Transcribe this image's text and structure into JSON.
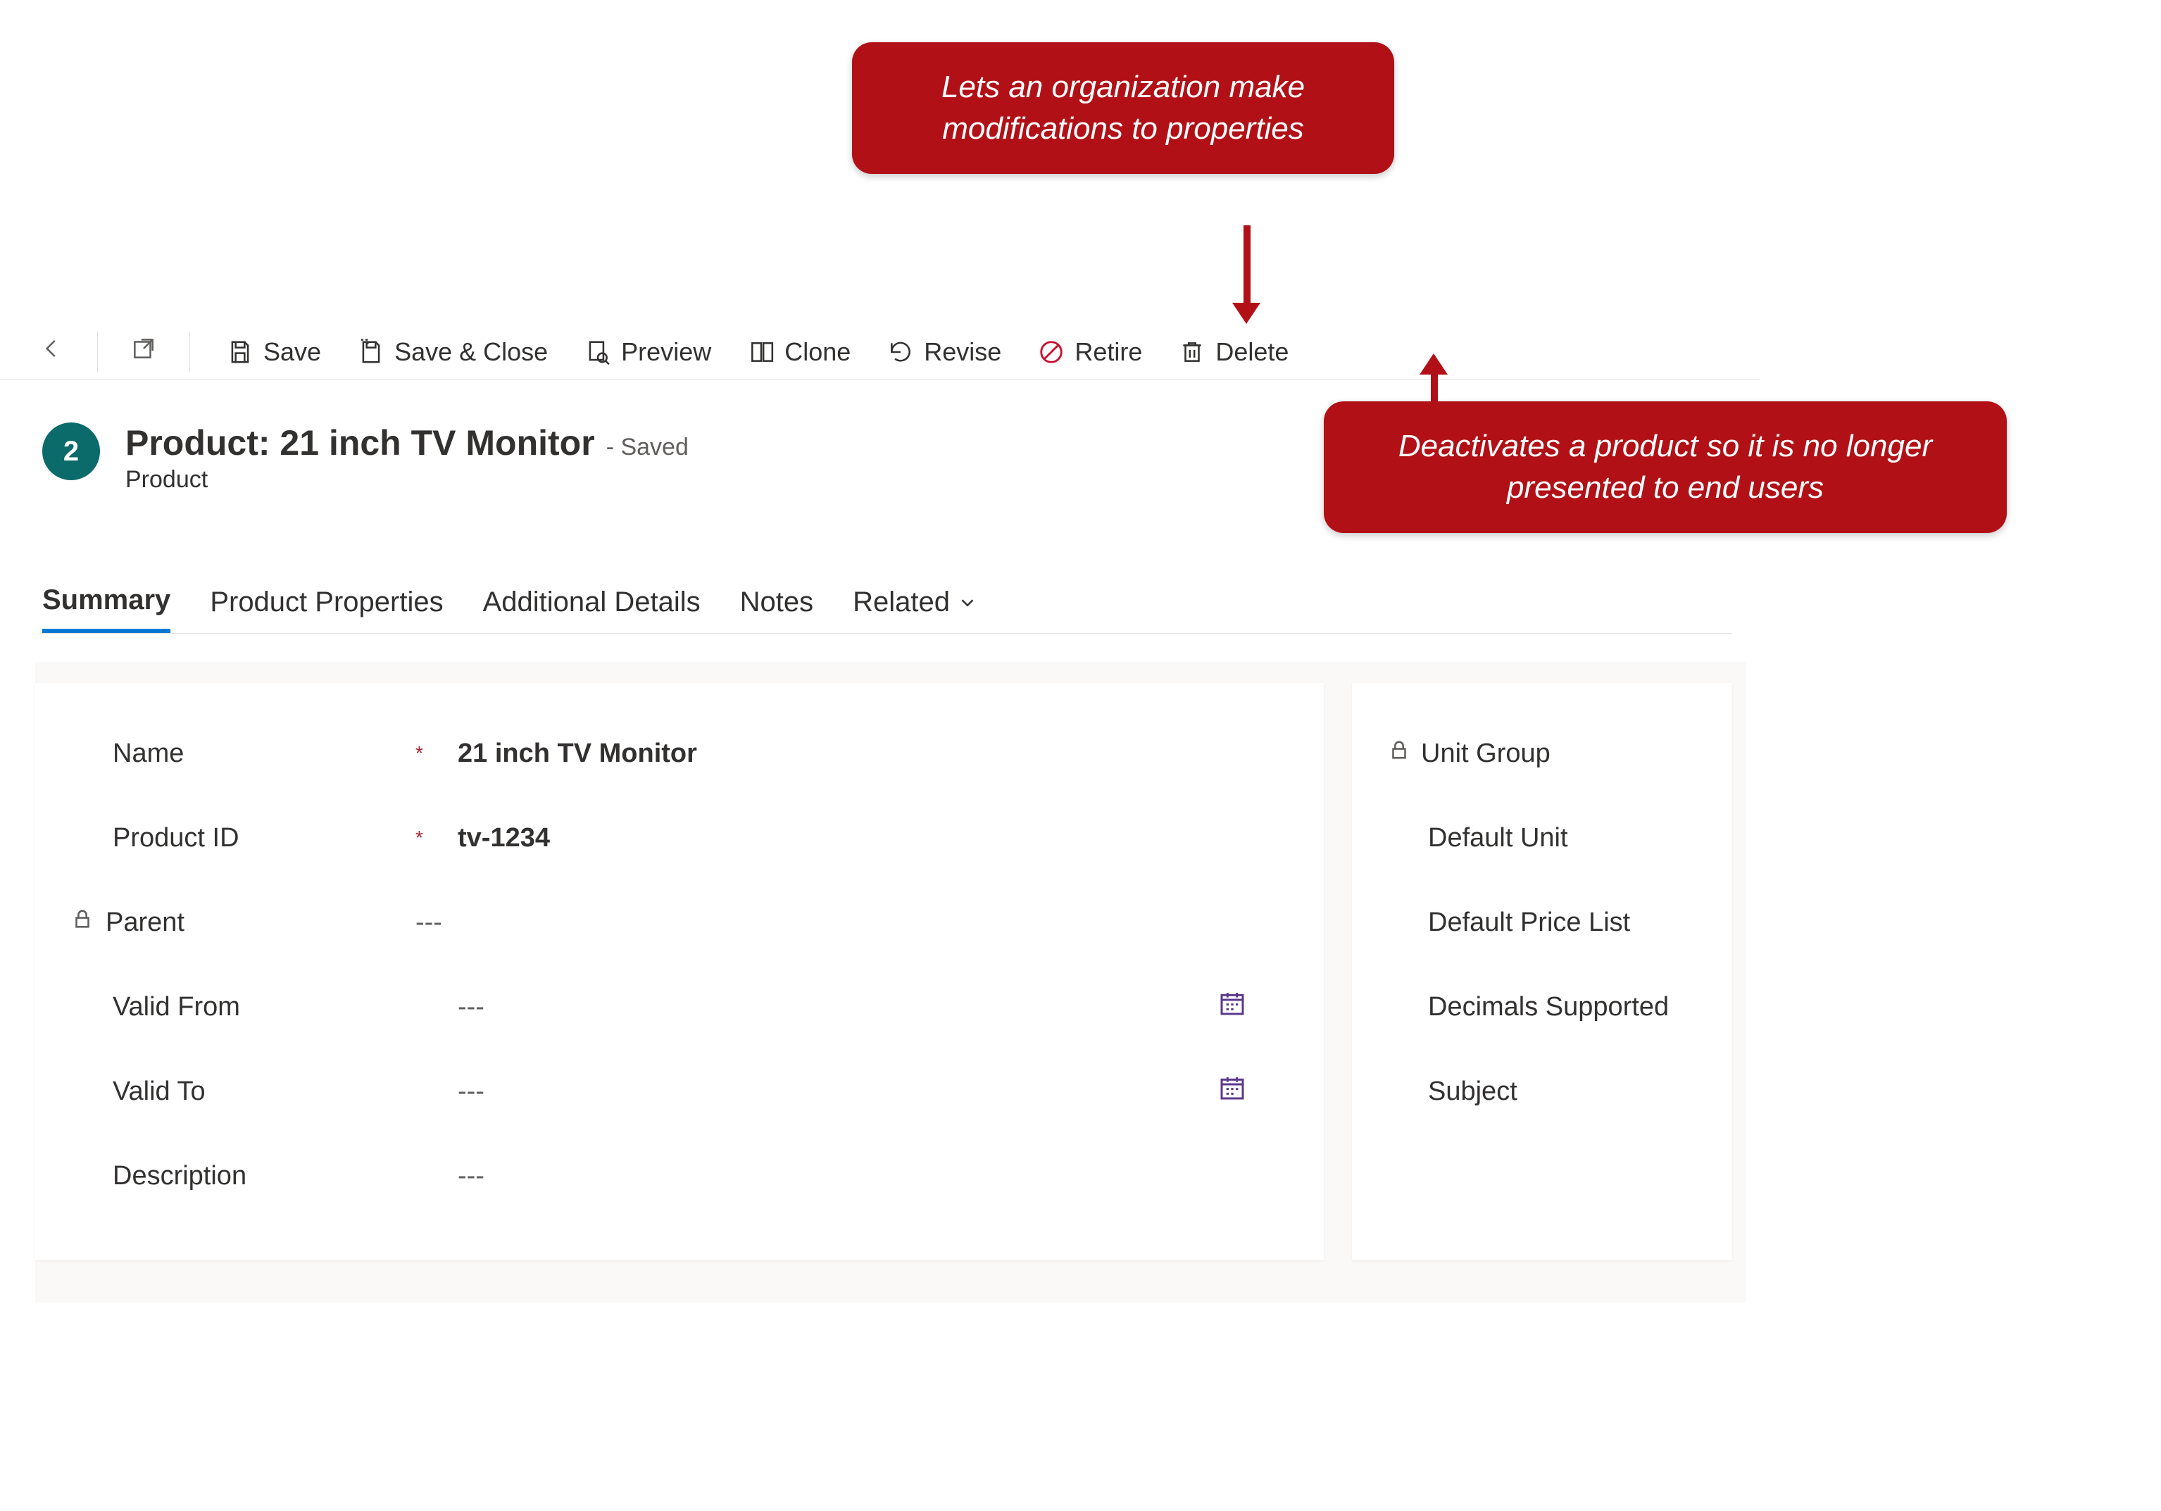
{
  "toolbar": {
    "save": "Save",
    "save_close": "Save & Close",
    "preview": "Preview",
    "clone": "Clone",
    "revise": "Revise",
    "retire": "Retire",
    "delete": "Delete"
  },
  "header": {
    "badge": "2",
    "title": "Product: 21 inch TV Monitor",
    "status": "- Saved",
    "subtitle": "Product"
  },
  "tabs": {
    "summary": "Summary",
    "product_properties": "Product Properties",
    "additional_details": "Additional Details",
    "notes": "Notes",
    "related": "Related"
  },
  "fields": {
    "name_label": "Name",
    "name_value": "21 inch TV Monitor",
    "product_id_label": "Product ID",
    "product_id_value": "tv-1234",
    "parent_label": "Parent",
    "parent_value": "---",
    "valid_from_label": "Valid From",
    "valid_from_value": "---",
    "valid_to_label": "Valid To",
    "valid_to_value": "---",
    "description_label": "Description",
    "description_value": "---"
  },
  "right": {
    "unit_group": "Unit Group",
    "default_unit": "Default Unit",
    "default_price_list": "Default Price List",
    "decimals_supported": "Decimals Supported",
    "subject": "Subject"
  },
  "callouts": {
    "revise": "Lets an organization make modifications to properties",
    "retire": "Deactivates a product so it is no longer presented to end users"
  },
  "required_marker": "*"
}
